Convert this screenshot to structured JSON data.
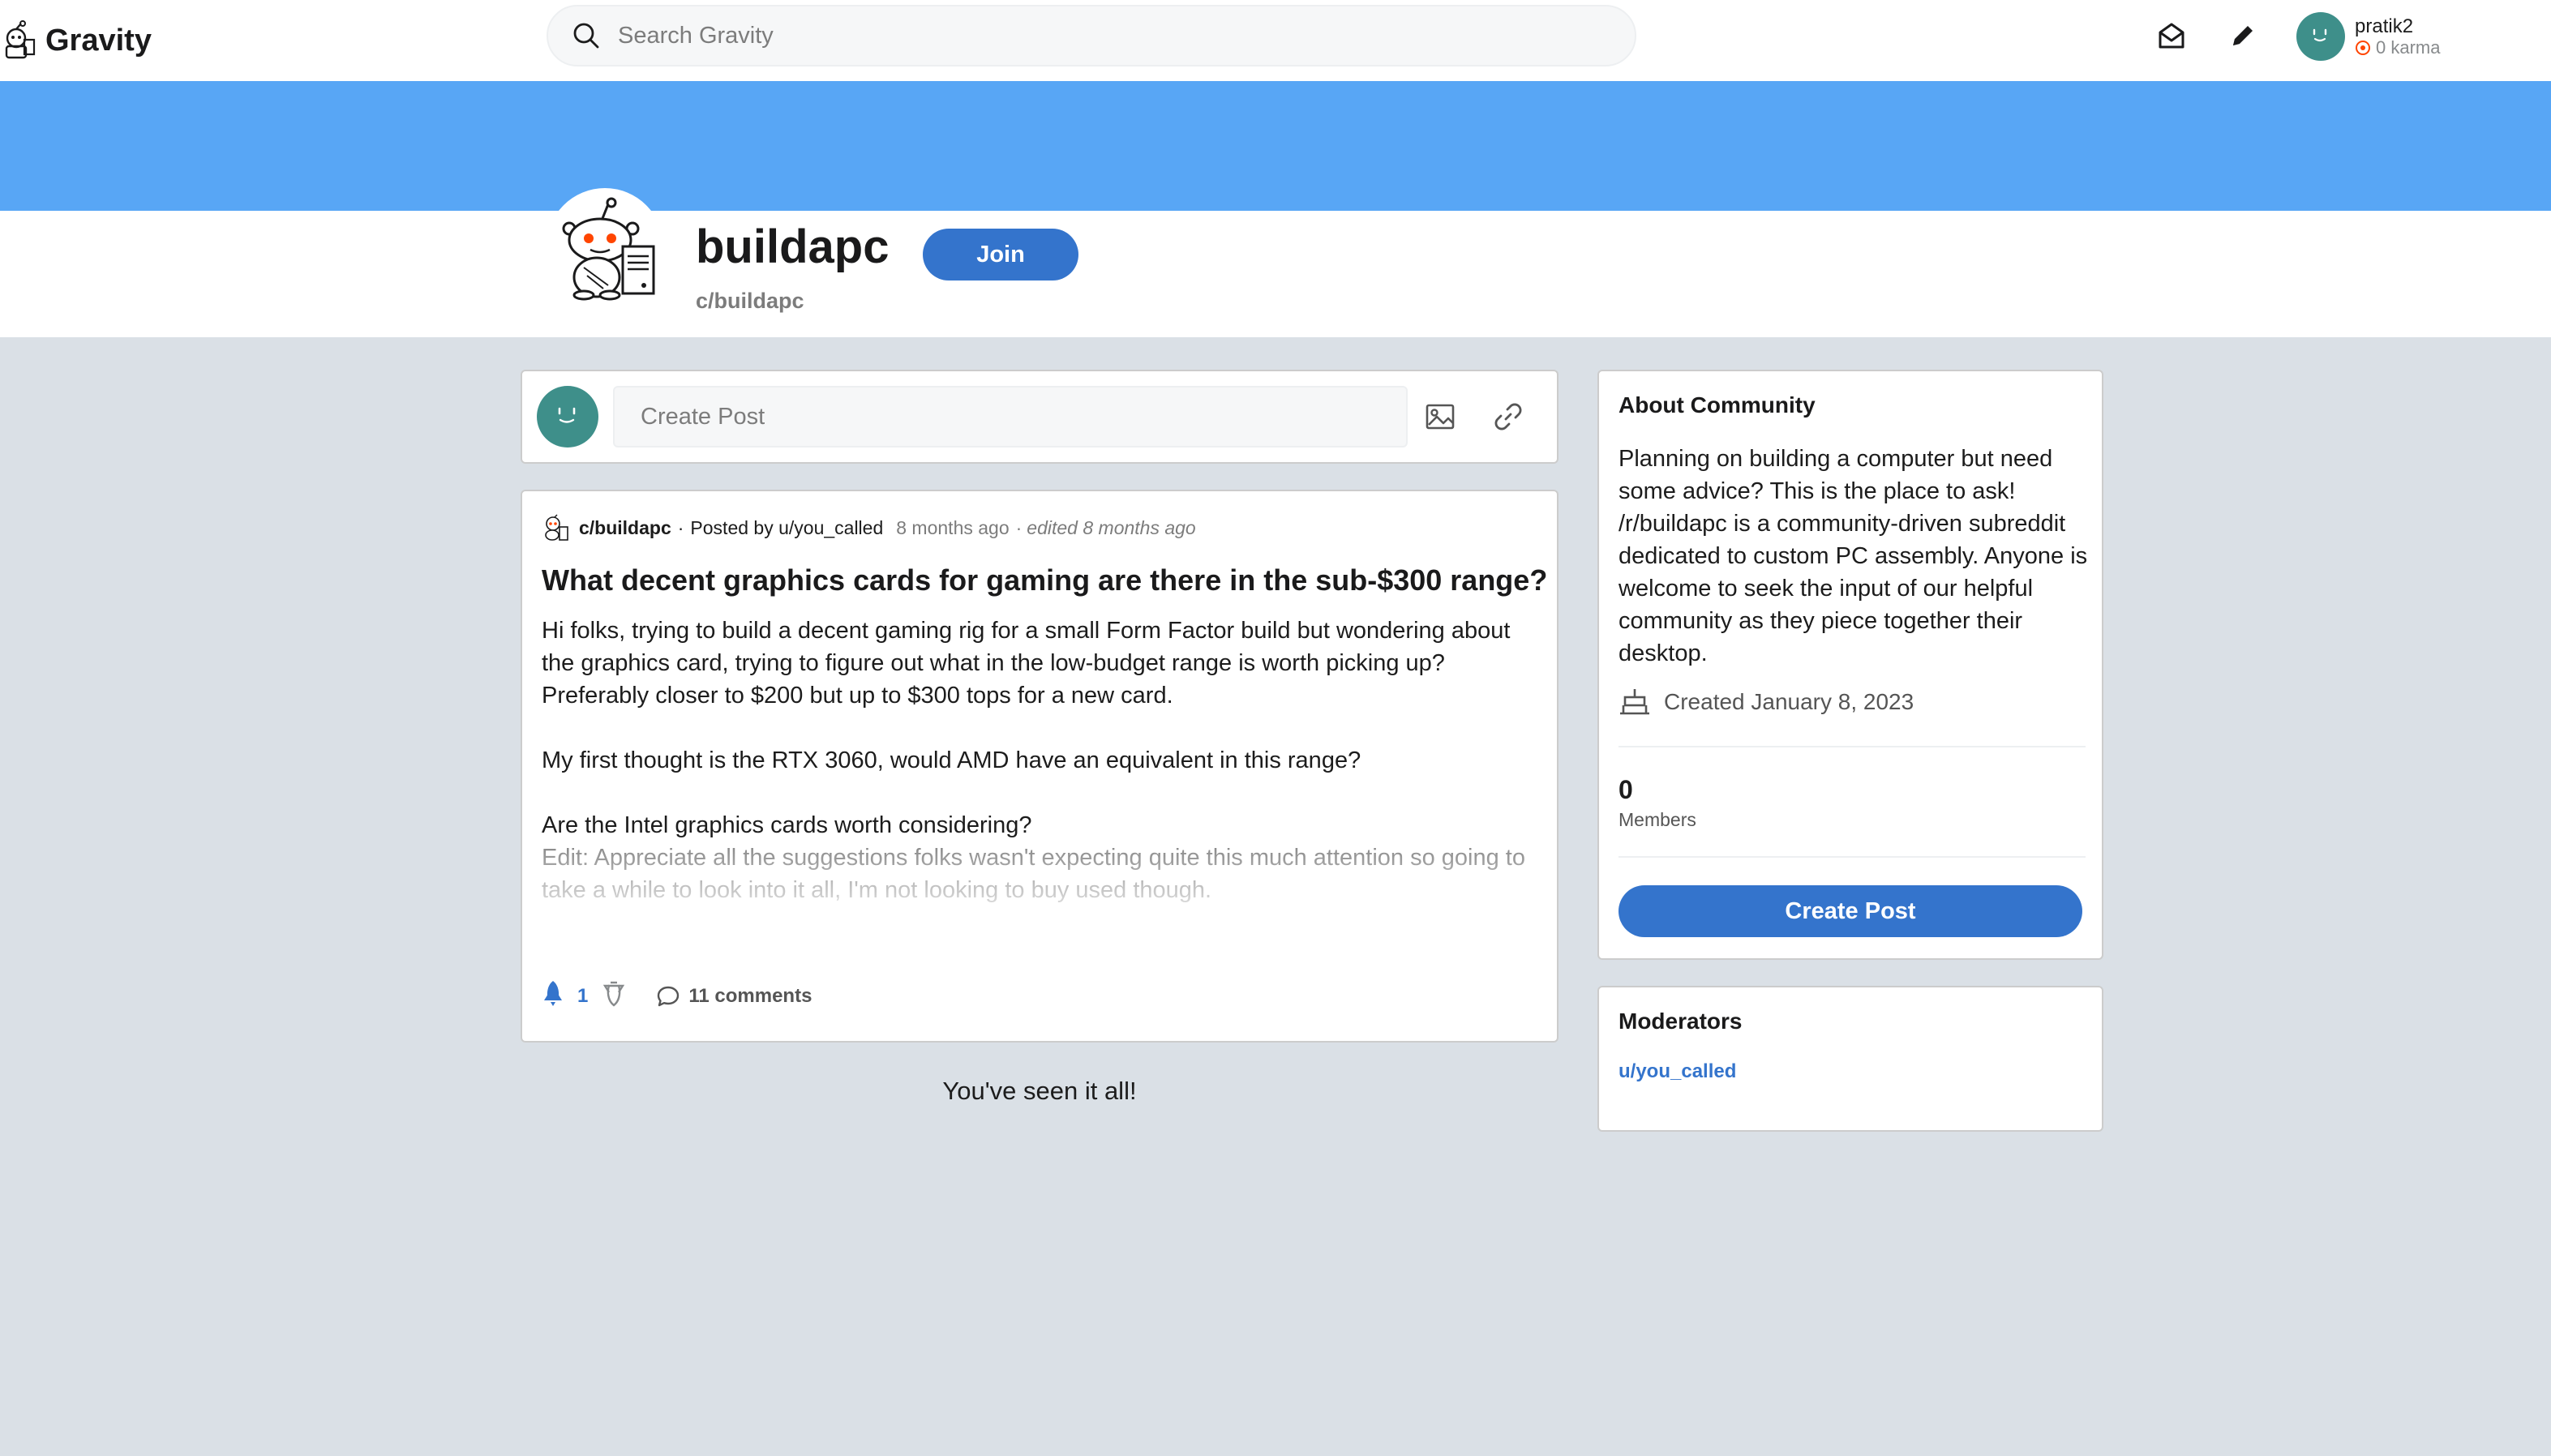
{
  "app": {
    "name": "Gravity"
  },
  "search": {
    "placeholder": "Search Gravity"
  },
  "user": {
    "name": "pratik2",
    "karma": "0 karma"
  },
  "community": {
    "name": "buildapc",
    "handle": "c/buildapc",
    "join_label": "Join",
    "banner_color": "#58a6f5"
  },
  "create_post": {
    "placeholder": "Create Post"
  },
  "post": {
    "subreddit": "c/buildapc",
    "posted_by": "Posted by u/you_called",
    "time": "8 months ago",
    "edited": "edited 8 months ago",
    "separator": "·",
    "title": "What decent graphics cards for gaming are there in the sub-$300 range?",
    "body": [
      "Hi folks, trying to build a decent gaming rig for a small Form Factor build but wondering about the graphics card, trying to figure out what in the low-budget range is worth picking up? Preferably closer to $200 but up to $300 tops for a new card.",
      "My first thought is the RTX 3060, would AMD have an equivalent in this range?",
      "Are the Intel graphics cards worth considering?"
    ],
    "edit_note": "Edit: Appreciate all the suggestions folks wasn't expecting quite this much attention so going to take a while to look into it all, I'm not looking to buy used though.",
    "votes": "1",
    "comments": "11 comments"
  },
  "feed": {
    "end_message": "You've seen it all!"
  },
  "about": {
    "heading": "About Community",
    "description": "Planning on building a computer but need some advice? This is the place to ask! /r/buildapc is a community-driven subreddit dedicated to custom PC assembly. Anyone is welcome to seek the input of our helpful community as they piece together their desktop.",
    "created": "Created January 8, 2023",
    "members_count": "0",
    "members_label": "Members",
    "create_post_label": "Create Post"
  },
  "moderators": {
    "heading": "Moderators",
    "list": [
      "u/you_called"
    ]
  },
  "colors": {
    "accent": "#3474cc",
    "background": "#dae0e6",
    "avatar": "#3e8f8a"
  }
}
